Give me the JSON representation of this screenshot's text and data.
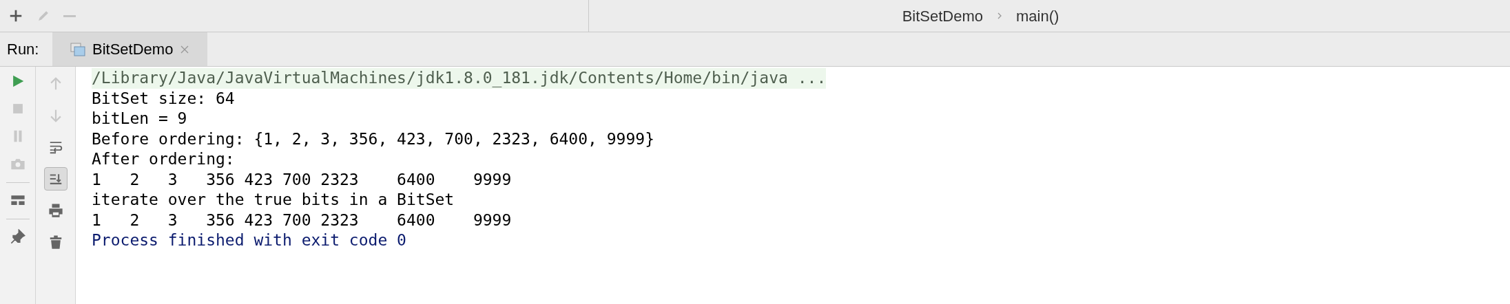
{
  "top_toolbar": [
    {
      "disabled": false
    },
    {
      "disabled": true
    },
    {
      "disabled": true
    }
  ],
  "breadcrumb": [
    "BitSetDemo",
    "main()"
  ],
  "run_bar": {
    "label": "Run:",
    "tabs": [
      {
        "label": "BitSetDemo",
        "selected": true
      }
    ]
  },
  "side_toolbar": [
    {
      "disabled": false
    },
    {
      "disabled": true
    },
    {
      "disabled": true
    },
    {
      "disabled": true
    },
    {
      "disabled": false
    },
    {
      "disabled": false
    }
  ],
  "console_toolbar": [
    {
      "disabled": true,
      "on": false
    },
    {
      "disabled": true,
      "on": false
    },
    {
      "disabled": false,
      "on": false
    },
    {
      "disabled": false,
      "on": true
    },
    {
      "disabled": false,
      "on": false
    },
    {
      "disabled": false,
      "on": false
    }
  ],
  "console_lines": [
    {
      "kind": "command",
      "text": "/Library/Java/JavaVirtualMachines/jdk1.8.0_181.jdk/Contents/Home/bin/java ..."
    },
    {
      "kind": "stdout",
      "text": "BitSet size: 64"
    },
    {
      "kind": "stdout",
      "text": "bitLen = 9"
    },
    {
      "kind": "stdout",
      "text": "Before ordering: {1, 2, 3, 356, 423, 700, 2323, 6400, 9999}"
    },
    {
      "kind": "stdout",
      "text": "After ordering:"
    },
    {
      "kind": "stdout",
      "text": "1   2   3   356 423 700 2323    6400    9999"
    },
    {
      "kind": "stdout",
      "text": "iterate over the true bits in a BitSet"
    },
    {
      "kind": "stdout",
      "text": "1   2   3   356 423 700 2323    6400    9999"
    },
    {
      "kind": "system",
      "text": "Process finished with exit code 0"
    }
  ]
}
